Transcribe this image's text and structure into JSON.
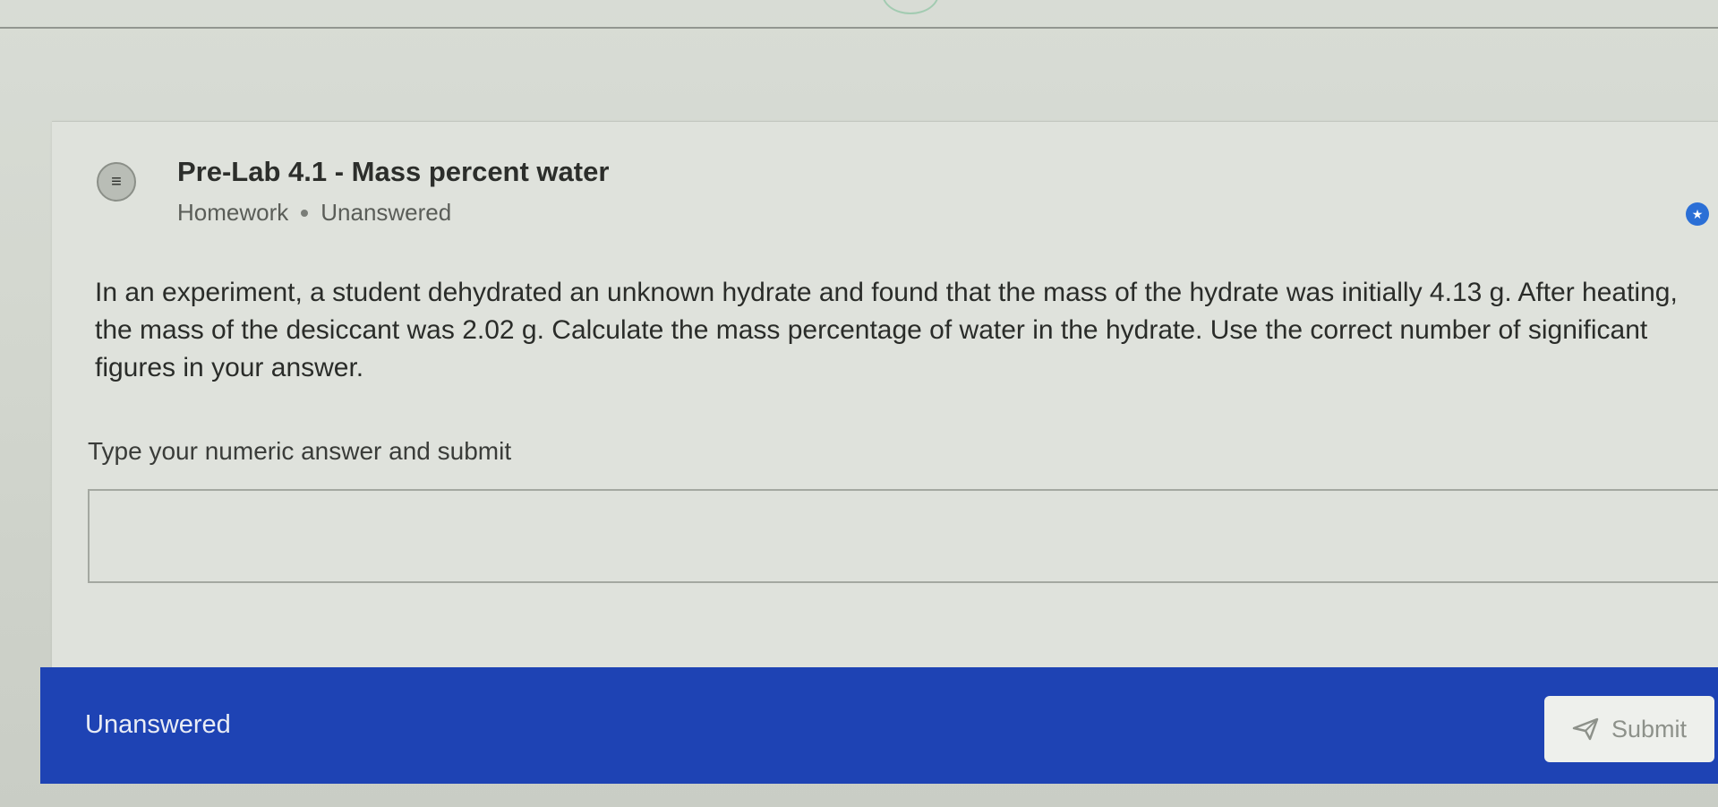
{
  "question_card": {
    "title": "Pre-Lab 4.1 - Mass percent water",
    "category": "Homework",
    "status": "Unanswered",
    "icon": "question-list-icon",
    "body": "In an experiment, a student dehydrated an unknown hydrate and found that the mass of the hydrate was initially 4.13 g. After heating, the mass of the desiccant was 2.02 g. Calculate the mass percentage of water in the hydrate. Use the correct number of significant figures in your answer."
  },
  "answer": {
    "label": "Type your numeric answer and submit",
    "value": ""
  },
  "footer": {
    "status": "Unanswered",
    "submit_label": "Submit",
    "submit_icon": "send-icon"
  },
  "colors": {
    "footer_bar": "#1e43b4",
    "badge": "#2b6fd6"
  }
}
